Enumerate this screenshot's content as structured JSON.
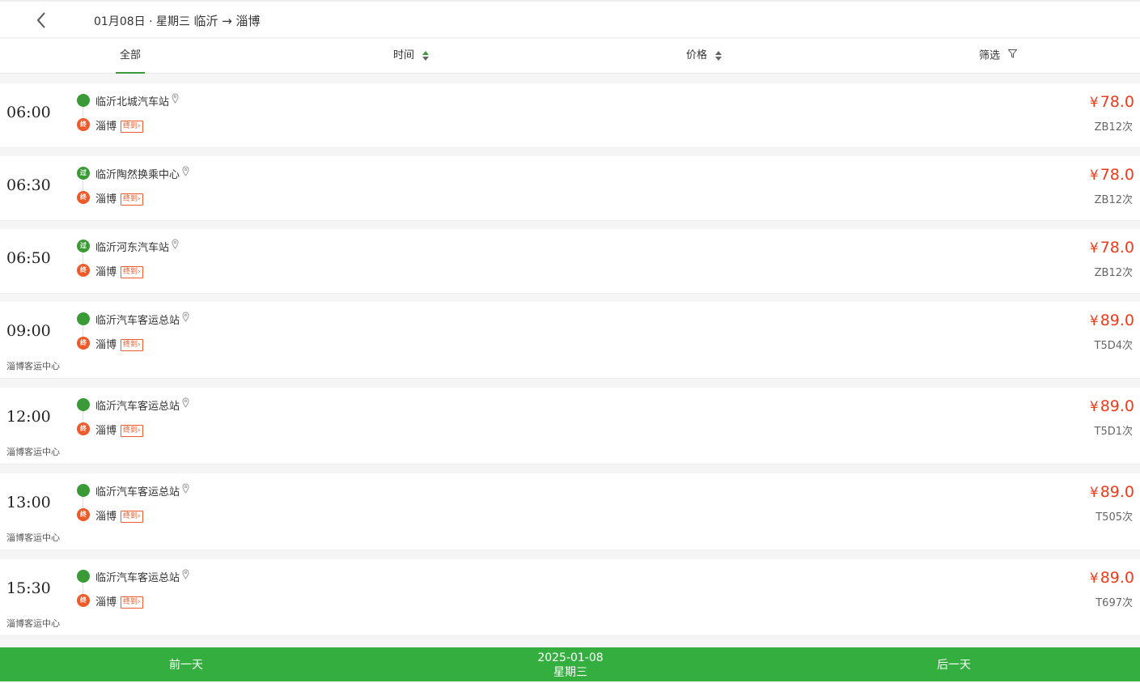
{
  "header": {
    "date": "01月08日 · 星期三",
    "route": "临沂 → 淄博"
  },
  "tabs": [
    {
      "label": "全部",
      "active": true
    },
    {
      "label": "时间"
    },
    {
      "label": "价格"
    },
    {
      "label": "筛选"
    }
  ],
  "colors": {
    "accent": "#3a9b36",
    "price": "#ee3b1a",
    "footer": "#34ae3e",
    "end_badge": "#ee5a2a"
  },
  "trips": [
    {
      "time": "06:00",
      "origin": "临沂北城汽车站",
      "origin_badge": "",
      "dest": "淄博",
      "dest_badge": "终",
      "dest_tag": "终到",
      "price": "78.0",
      "yen": "¥",
      "train": "ZB12次",
      "sub": ""
    },
    {
      "time": "06:30",
      "origin": "临沂陶然换乘中心",
      "origin_badge": "过",
      "dest": "淄博",
      "dest_badge": "终",
      "dest_tag": "终到",
      "price": "78.0",
      "yen": "¥",
      "train": "ZB12次",
      "sub": ""
    },
    {
      "time": "06:50",
      "origin": "临沂河东汽车站",
      "origin_badge": "过",
      "dest": "淄博",
      "dest_badge": "终",
      "dest_tag": "终到",
      "price": "78.0",
      "yen": "¥",
      "train": "ZB12次",
      "sub": ""
    },
    {
      "time": "09:00",
      "origin": "临沂汽车客运总站",
      "origin_badge": "",
      "dest": "淄博",
      "dest_badge": "终",
      "dest_tag": "终到",
      "price": "89.0",
      "yen": "¥",
      "train": "T5D4次",
      "sub": "淄博客运中心"
    },
    {
      "time": "12:00",
      "origin": "临沂汽车客运总站",
      "origin_badge": "",
      "dest": "淄博",
      "dest_badge": "终",
      "dest_tag": "终到",
      "price": "89.0",
      "yen": "¥",
      "train": "T5D1次",
      "sub": "淄博客运中心"
    },
    {
      "time": "13:00",
      "origin": "临沂汽车客运总站",
      "origin_badge": "",
      "dest": "淄博",
      "dest_badge": "终",
      "dest_tag": "终到",
      "price": "89.0",
      "yen": "¥",
      "train": "T505次",
      "sub": "淄博客运中心"
    },
    {
      "time": "15:30",
      "origin": "临沂汽车客运总站",
      "origin_badge": "",
      "dest": "淄博",
      "dest_badge": "终",
      "dest_tag": "终到",
      "price": "89.0",
      "yen": "¥",
      "train": "T697次",
      "sub": "淄博客运中心"
    }
  ],
  "footer": {
    "prev": "前一天",
    "date": "2025-01-08",
    "weekday": "星期三",
    "next": "后一天"
  }
}
